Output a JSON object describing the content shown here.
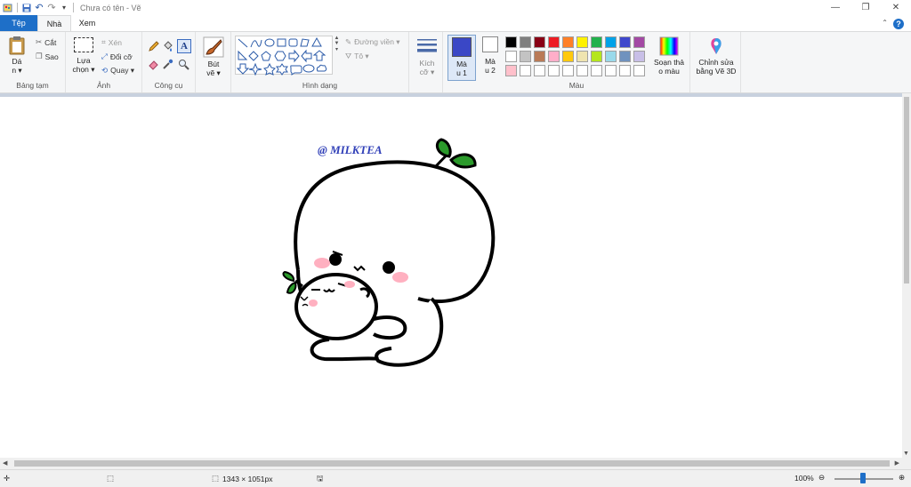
{
  "window": {
    "title": "Chưa có tên - Vẽ"
  },
  "tabs": {
    "file": "Tệp",
    "home": "Nhà",
    "view": "Xem"
  },
  "clipboard": {
    "paste": "Dá\nn ▾",
    "cut": "Cắt",
    "copy": "Sao",
    "label": "Bảng tạm"
  },
  "image": {
    "select": "Lựa\nchọn ▾",
    "crop": "Xén",
    "resize": "Đổi cỡ",
    "rotate": "Quay ▾",
    "label": "Ảnh"
  },
  "tools": {
    "label": "Công cụ"
  },
  "brushes": {
    "label": "Bút\nvẽ ▾"
  },
  "shapes": {
    "outline": "Đường viền ▾",
    "fill": "Tô ▾",
    "label": "Hình dạng"
  },
  "size": {
    "label": "Kích\ncỡ ▾"
  },
  "color1": {
    "label": "Mà\nu 1",
    "value": "#3a47c6"
  },
  "color2": {
    "label": "Mà\nu 2",
    "value": "#ffffff"
  },
  "colors": {
    "label": "Màu",
    "row1": [
      "#000000",
      "#7f7f7f",
      "#880015",
      "#ed1c24",
      "#ff7f27",
      "#fff200",
      "#22b14c",
      "#00a2e8",
      "#3f48cc",
      "#a349a4"
    ],
    "row2": [
      "#ffffff",
      "#c3c3c3",
      "#b97a57",
      "#ffaec9",
      "#ffc90e",
      "#efe4b0",
      "#b5e61d",
      "#99d9ea",
      "#7092be",
      "#c8bfe7"
    ],
    "row3": [
      "#ffc0cb",
      "#ffffff",
      "#ffffff",
      "#ffffff",
      "#ffffff",
      "#ffffff",
      "#ffffff",
      "#ffffff",
      "#ffffff",
      "#ffffff"
    ]
  },
  "edit_colors": {
    "label": "Soạn thả\no màu"
  },
  "paint3d": {
    "label": "Chỉnh sửa\nbằng Vẽ 3D"
  },
  "drawing": {
    "watermark": "@ MILKTEA"
  },
  "status": {
    "dimensions": "1343 × 1051px",
    "zoom": "100%",
    "zoom_level_percent": 100
  }
}
